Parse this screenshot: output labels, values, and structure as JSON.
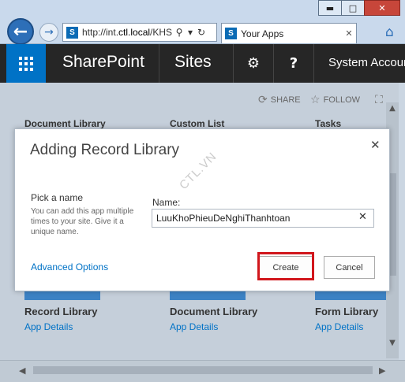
{
  "browser": {
    "url_prefix": "http://int.",
    "url_host": "ctl.local",
    "url_suffix": "/KHS",
    "tab_title": "Your Apps",
    "window_buttons": [
      "▬",
      "□",
      "✕"
    ]
  },
  "suitebar": {
    "brand": "SharePoint",
    "link": "Sites",
    "user": "System Account"
  },
  "page": {
    "actions": {
      "share": "SHARE",
      "follow": "FOLLOW"
    },
    "tiles_top": [
      "Document Library",
      "Custom List",
      "Tasks"
    ],
    "tiles_bottom": [
      {
        "name": "Record Library",
        "link": "App Details"
      },
      {
        "name": "Document Library",
        "link": "App Details"
      },
      {
        "name": "Form Library",
        "link": "App Details"
      }
    ]
  },
  "dialog": {
    "title": "Adding Record Library",
    "pick_label": "Pick a name",
    "pick_help": "You can add this app multiple times to your site. Give it a unique name.",
    "name_label": "Name:",
    "name_value": "LuuKhoPhieuDeNghiThanhtoan",
    "advanced_link": "Advanced Options",
    "create_label": "Create",
    "cancel_label": "Cancel"
  },
  "watermark": "CTL.VN",
  "icons": {
    "back": "back-arrow-icon",
    "forward": "forward-arrow-icon",
    "search": "search-icon",
    "refresh": "refresh-icon",
    "home": "home-icon",
    "settings": "gear-icon",
    "help": "help-icon",
    "share": "share-icon",
    "follow": "star-icon",
    "focus": "focus-icon",
    "close": "close-icon"
  },
  "colors": {
    "accent": "#0072c6",
    "suitebar": "#262626",
    "highlight": "#d1161c"
  }
}
